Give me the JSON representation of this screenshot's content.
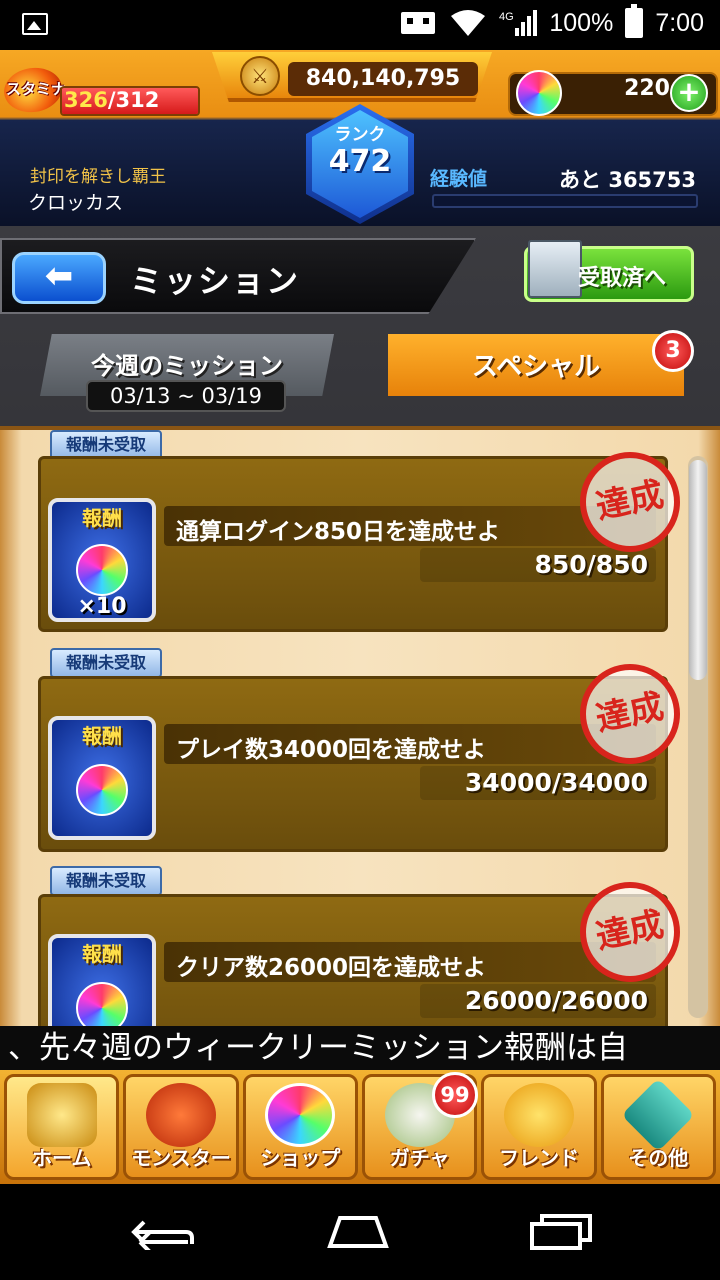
{
  "status_bar": {
    "network": "4G",
    "battery": "100%",
    "time": "7:00"
  },
  "header": {
    "stamina_label": "スタミナ",
    "stamina_current": "326",
    "stamina_max": "/312",
    "stamina_fill": 1.0,
    "gold": "840,140,795",
    "orbs": "220",
    "rank_label": "ランク",
    "rank": "472",
    "player_title": "封印を解きし覇王",
    "player_name": "クロッカス",
    "exp_label": "経験値",
    "exp_remaining": "あと 365753"
  },
  "titlebar": {
    "title": "ミッション",
    "received_button": "受取済へ"
  },
  "tabs": {
    "weekly_label": "今週のミッション",
    "weekly_dates": "03/13 ~ 03/19",
    "special_label": "スペシャル",
    "special_badge": "3"
  },
  "missions": [
    {
      "tag": "報酬未受取",
      "reward_label": "報酬",
      "reward_qty": "×10",
      "name": "通算ログイン850日を達成せよ",
      "progress": "850/850",
      "stamp": "達成"
    },
    {
      "tag": "報酬未受取",
      "reward_label": "報酬",
      "reward_qty": "",
      "name": "プレイ数34000回を達成せよ",
      "progress": "34000/34000",
      "stamp": "達成"
    },
    {
      "tag": "報酬未受取",
      "reward_label": "報酬",
      "reward_qty": "",
      "name": "クリア数26000回を達成せよ",
      "progress": "26000/26000",
      "stamp": "達成"
    }
  ],
  "ticker": "、先々週のウィークリーミッション報酬は自",
  "bottom_nav": {
    "items": [
      "ホーム",
      "モンスター",
      "ショップ",
      "ガチャ",
      "フレンド",
      "その他"
    ],
    "gacha_badge": "99"
  },
  "colors": {
    "accent_orange": "#f6a824",
    "stamp_red": "#d8241c",
    "tab_active": "#e7820a"
  }
}
